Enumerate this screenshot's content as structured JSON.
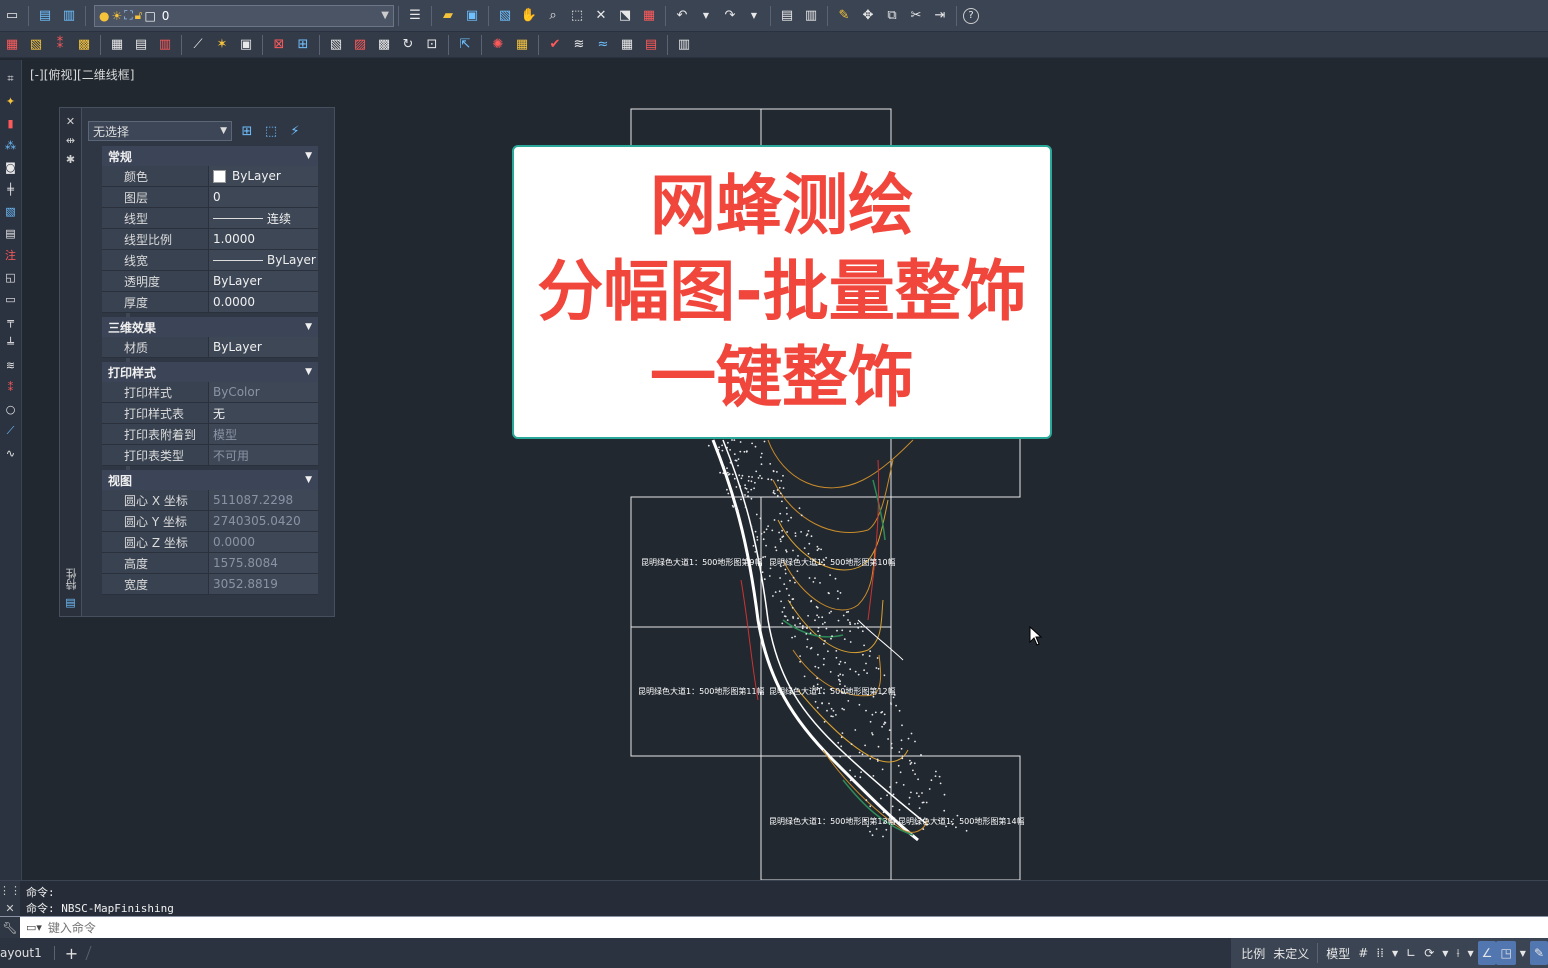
{
  "toolbar": {
    "layer_name": "0"
  },
  "viewport": {
    "view_label": "[-][俯视][二维线框]"
  },
  "properties": {
    "panel_title": "特性",
    "selection": "无选择",
    "sections": [
      {
        "title": "常规",
        "rows": [
          {
            "key": "颜色",
            "value": "ByLayer"
          },
          {
            "key": "图层",
            "value": "0"
          },
          {
            "key": "线型",
            "value": "连续"
          },
          {
            "key": "线型比例",
            "value": "1.0000"
          },
          {
            "key": "线宽",
            "value": "ByLayer"
          },
          {
            "key": "透明度",
            "value": "ByLayer"
          },
          {
            "key": "厚度",
            "value": "0.0000"
          }
        ]
      },
      {
        "title": "三维效果",
        "rows": [
          {
            "key": "材质",
            "value": "ByLayer"
          }
        ]
      },
      {
        "title": "打印样式",
        "rows": [
          {
            "key": "打印样式",
            "value": "ByColor"
          },
          {
            "key": "打印样式表",
            "value": "无"
          },
          {
            "key": "打印表附着到",
            "value": "模型"
          },
          {
            "key": "打印表类型",
            "value": "不可用"
          }
        ]
      },
      {
        "title": "视图",
        "rows": [
          {
            "key": "圆心 X 坐标",
            "value": "511087.2298"
          },
          {
            "key": "圆心 Y 坐标",
            "value": "2740305.0420"
          },
          {
            "key": "圆心 Z 坐标",
            "value": "0.0000"
          },
          {
            "key": "高度",
            "value": "1575.8084"
          },
          {
            "key": "宽度",
            "value": "3052.8819"
          }
        ]
      }
    ]
  },
  "drawing": {
    "sheet_labels": [
      "昆明绿色大道1：500地形图第9幅",
      "昆明绿色大道1：500地形图第10幅",
      "昆明绿色大道1：500地形图第11幅",
      "昆明绿色大道1：500地形图第12幅",
      "昆明绿色大道1：500地形图第13幅",
      "昆明绿色大道1：500地形图第14幅"
    ]
  },
  "overlay": {
    "line1": "网蜂测绘",
    "line2": "分幅图-批量整饰",
    "line3": "一键整饰"
  },
  "command": {
    "history1": "命令:",
    "history2": "命令: NBSC-MapFinishing",
    "placeholder": "键入命令"
  },
  "status": {
    "layout_tab": "ayout1",
    "add_tab": "+",
    "scale_label": "比例",
    "scale_value": "未定义",
    "model_label": "模型"
  },
  "colors": {
    "background": "#212830",
    "overlay_text": "#f0463c",
    "overlay_border": "#2aa89a"
  }
}
